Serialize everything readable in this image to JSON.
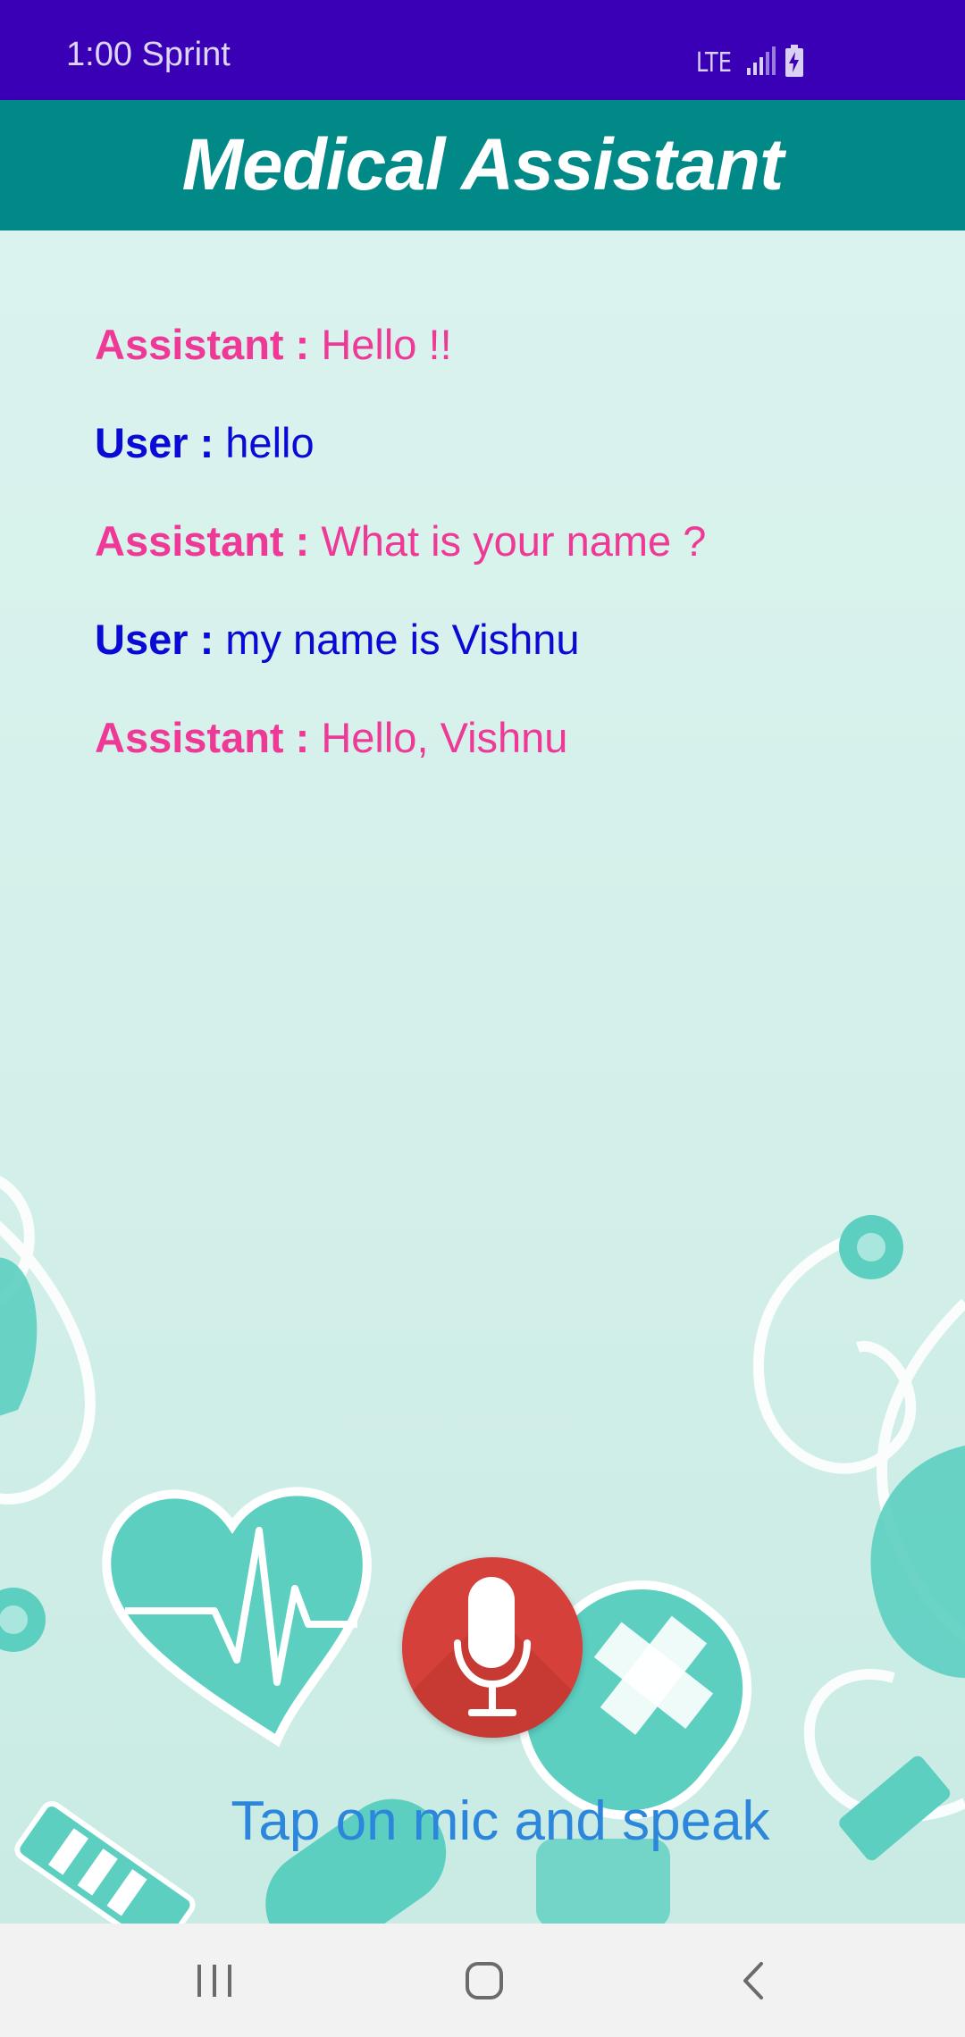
{
  "status_bar": {
    "time_carrier": "1:00 Sprint",
    "network": "LTE",
    "icons": [
      "signal-icon",
      "battery-charging-icon"
    ]
  },
  "app_bar": {
    "title": "Medical Assistant"
  },
  "conversation": [
    {
      "role": "assistant",
      "speaker": "Assistant :",
      "text": "Hello !!"
    },
    {
      "role": "user",
      "speaker": "User :",
      "text": "hello"
    },
    {
      "role": "assistant",
      "speaker": "Assistant :",
      "text": "What is your name ?"
    },
    {
      "role": "user",
      "speaker": "User :",
      "text": "my name is Vishnu"
    },
    {
      "role": "assistant",
      "speaker": "Assistant :",
      "text": "Hello, Vishnu"
    }
  ],
  "mic": {
    "icon": "microphone-icon"
  },
  "hint": "Tap on mic and speak",
  "nav_bar": {
    "icons": [
      "recent-apps-icon",
      "home-icon",
      "back-icon"
    ]
  },
  "colors": {
    "status_bar": "#3a00b5",
    "app_bar": "#008986",
    "assistant_text": "#ee3a96",
    "user_text": "#0a0ad6",
    "mic_button": "#d5403a",
    "hint_text": "#2c86dc"
  }
}
